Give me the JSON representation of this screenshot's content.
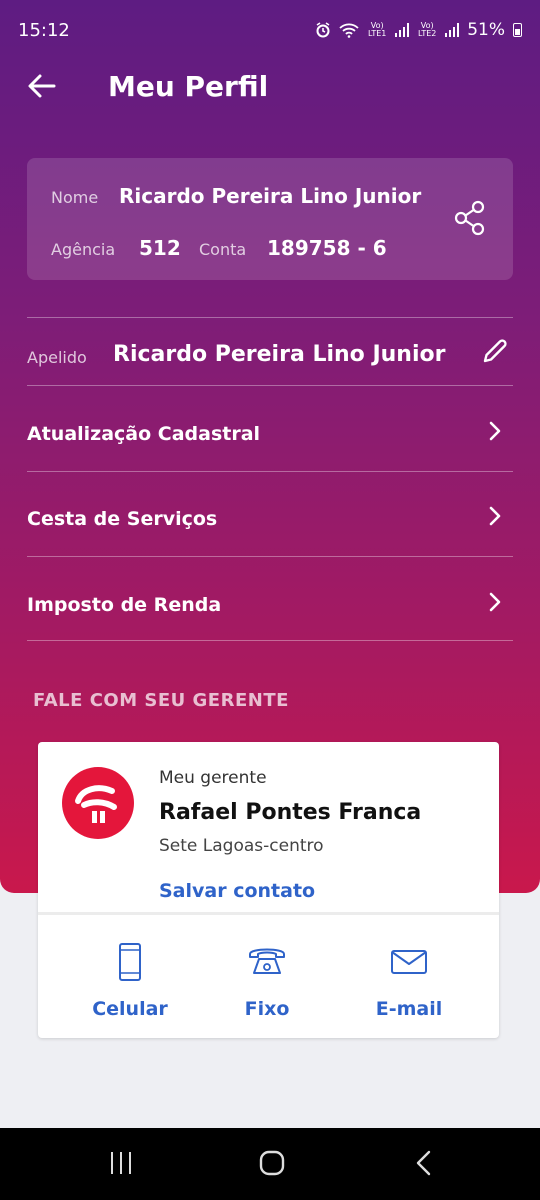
{
  "status": {
    "time": "15:12",
    "battery": "51%",
    "lte1": "Vo) LTE1",
    "lte2": "Vo) LTE2"
  },
  "header": {
    "title": "Meu Perfil"
  },
  "profile": {
    "nome_label": "Nome",
    "nome": "Ricardo Pereira Lino Junior",
    "agencia_label": "Agência",
    "agencia": "512",
    "conta_label": "Conta",
    "conta": "189758 - 6"
  },
  "apelido": {
    "label": "Apelido",
    "value": "Ricardo Pereira Lino Junior"
  },
  "menu": [
    {
      "label": "Atualização Cadastral"
    },
    {
      "label": "Cesta de Serviços"
    },
    {
      "label": "Imposto de Renda"
    }
  ],
  "section_title": "FALE COM SEU GERENTE",
  "gerente": {
    "label": "Meu gerente",
    "name": "Rafael Pontes Franca",
    "location": "Sete Lagoas-centro",
    "save_label": "Salvar contato",
    "actions": [
      {
        "label": "Celular",
        "icon": "mobile-phone-icon"
      },
      {
        "label": "Fixo",
        "icon": "landline-phone-icon"
      },
      {
        "label": "E-mail",
        "icon": "envelope-icon"
      }
    ]
  },
  "colors": {
    "accent": "#2f63c9",
    "brand": "#e4163b",
    "header_top": "#5e1c82",
    "header_bottom": "#c9184c"
  }
}
